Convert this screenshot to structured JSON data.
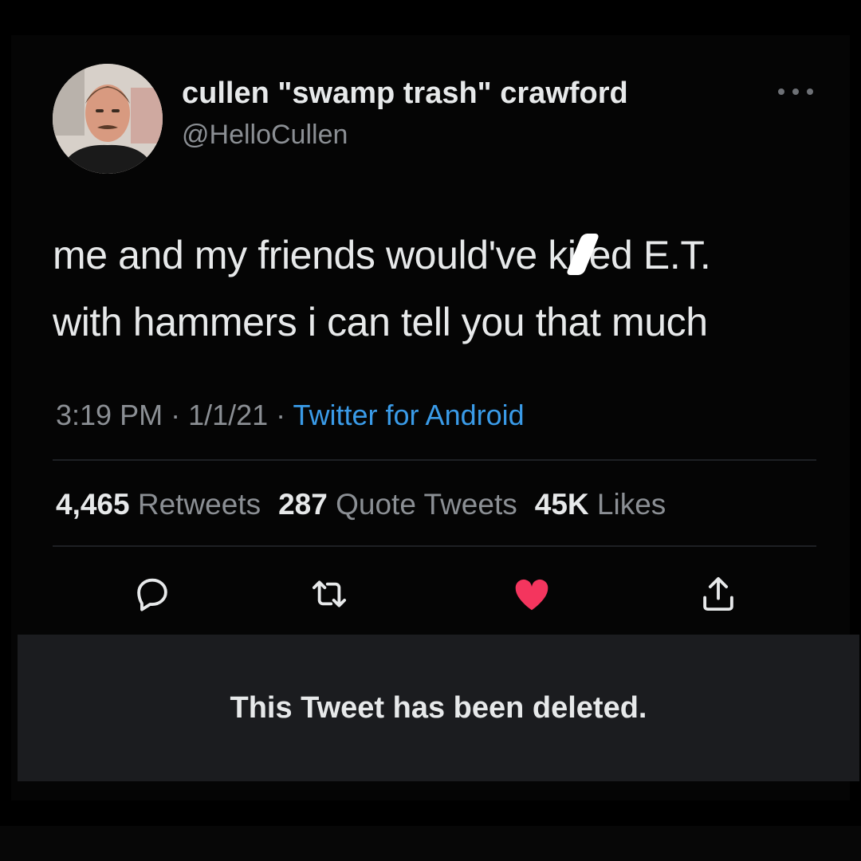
{
  "user": {
    "display_name": "cullen \"swamp trash\" crawford",
    "handle": "@HelloCullen"
  },
  "tweet": {
    "line1_before": "me and my friends would've ki",
    "line1_after": "ed E.T.",
    "line2": "with hammers i can tell you that much"
  },
  "meta": {
    "time": "3:19 PM",
    "sep1": " · ",
    "date": "1/1/21",
    "sep2": " · ",
    "source": "Twitter for Android"
  },
  "stats": {
    "retweets_count": "4,465",
    "retweets_label": "Retweets",
    "quotes_count": "287",
    "quotes_label": "Quote Tweets",
    "likes_count": "45K",
    "likes_label": "Likes"
  },
  "actions": {
    "icons": [
      "reply-icon",
      "retweet-icon",
      "like-icon",
      "share-icon"
    ],
    "like_color": "#f4355e",
    "icon_color": "#e7e9ea"
  },
  "banner": {
    "text": "This Tweet has been deleted."
  },
  "colors": {
    "background": "#000000",
    "text_primary": "#e7e9ea",
    "text_secondary": "#8b8f94",
    "link": "#3a9be8",
    "banner_bg": "#1b1c1f"
  }
}
